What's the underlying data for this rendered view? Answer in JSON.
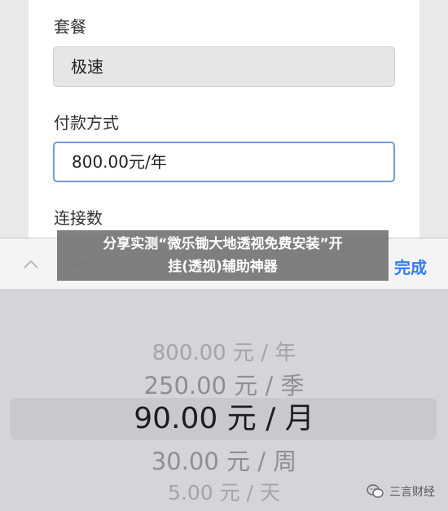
{
  "form": {
    "package_label": "套餐",
    "package_value": "极速",
    "payment_label": "付款方式",
    "payment_value": "800.00元/年",
    "connections_label": "连接数"
  },
  "toolbar": {
    "done_label": "完成"
  },
  "picker": {
    "options": [
      "800.00 元 / 年",
      "250.00 元 / 季",
      "90.00 元 / 月",
      "30.00 元 / 周",
      "5.00 元 / 天"
    ],
    "selected_index": 2
  },
  "banner": {
    "line1": "分享实测“微乐锄大地透视免费安装”开",
    "line2": "挂(透视)辅助神器"
  },
  "watermark": {
    "text": "三言财经",
    "icon": "wechat-icon"
  }
}
